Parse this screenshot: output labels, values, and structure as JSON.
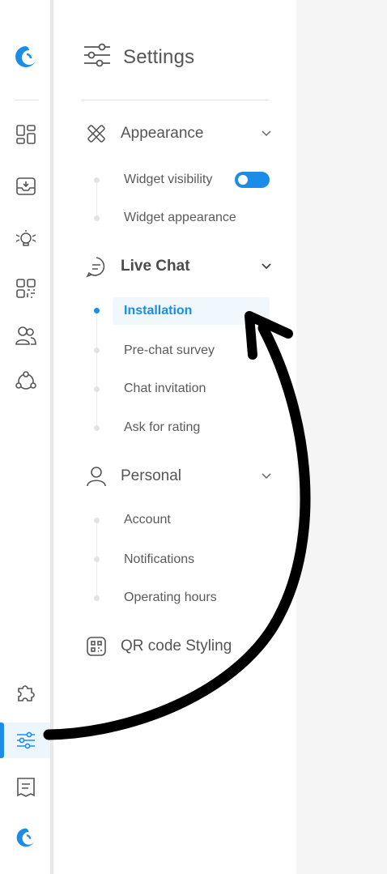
{
  "settings": {
    "title": "Settings",
    "icon": "sliders-icon"
  },
  "rail": {
    "top_logo": "brand-logo-icon",
    "items": [
      {
        "name": "dashboard-icon"
      },
      {
        "name": "inbox-icon"
      },
      {
        "name": "bot-icon"
      },
      {
        "name": "qr-code-icon"
      },
      {
        "name": "users-icon"
      },
      {
        "name": "integrations-icon"
      }
    ],
    "bottom_items": [
      {
        "name": "puzzle-icon"
      },
      {
        "name": "sliders-icon",
        "active": true
      },
      {
        "name": "notes-icon"
      }
    ],
    "bottom_logo": "brand-logo-icon"
  },
  "sections": {
    "appearance": {
      "label": "Appearance",
      "icon": "design-tools-icon",
      "items": [
        "Widget visibility",
        "Widget appearance"
      ],
      "widget_visibility_toggle": true
    },
    "live_chat": {
      "label": "Live Chat",
      "icon": "chat-bubble-icon",
      "items": [
        "Installation",
        "Pre-chat survey",
        "Chat invitation",
        "Ask for rating"
      ],
      "active_item": "Installation"
    },
    "personal": {
      "label": "Personal",
      "icon": "user-icon",
      "items": [
        "Account",
        "Notifications",
        "Operating hours"
      ]
    },
    "qr": {
      "label": "QR code Styling",
      "icon": "qr-code-icon"
    }
  },
  "colors": {
    "accent": "#1b8de8",
    "annotation": "#000000"
  }
}
